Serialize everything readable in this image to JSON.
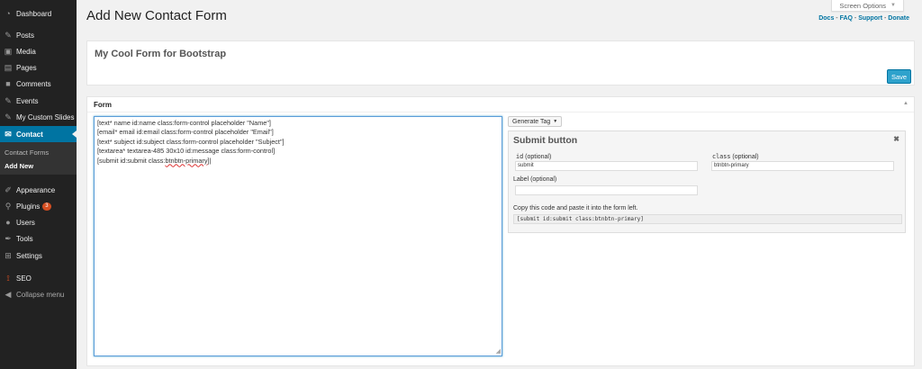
{
  "sidebar": {
    "items": [
      {
        "label": "Dashboard",
        "icon": "dashboard-icon"
      },
      {
        "label": "Posts",
        "icon": "pin-icon"
      },
      {
        "label": "Media",
        "icon": "media-icon"
      },
      {
        "label": "Pages",
        "icon": "pages-icon"
      },
      {
        "label": "Comments",
        "icon": "comment-icon"
      },
      {
        "label": "Events",
        "icon": "pin-icon"
      },
      {
        "label": "My Custom Slides",
        "icon": "pin-icon"
      },
      {
        "label": "Contact",
        "icon": "mail-icon"
      },
      {
        "label": "Appearance",
        "icon": "paintbrush-icon"
      },
      {
        "label": "Plugins",
        "icon": "plugin-icon",
        "badge": "3"
      },
      {
        "label": "Users",
        "icon": "users-icon"
      },
      {
        "label": "Tools",
        "icon": "wrench-icon"
      },
      {
        "label": "Settings",
        "icon": "settings-icon"
      },
      {
        "label": "SEO",
        "icon": "seo-icon"
      },
      {
        "label": "Collapse menu",
        "icon": "collapse-icon"
      }
    ],
    "submenu": [
      "Contact Forms",
      "Add New"
    ]
  },
  "header": {
    "title": "Add New Contact Form",
    "screen_options": "Screen Options",
    "links": {
      "docs": "Docs",
      "faq": "FAQ",
      "support": "Support",
      "donate": "Donate",
      "sep": " - "
    }
  },
  "title_box": {
    "form_title": "My Cool Form for Bootstrap",
    "save_label": "Save"
  },
  "form_panel": {
    "header": "Form",
    "code_lines": [
      "[text* name id:name class:form-control placeholder \"Name\"]",
      "[email* email id:email class:form-control placeholder \"Email\"]",
      "[text* subject id:subject class:form-control placeholder \"Subject\"]",
      "[textarea* textarea-485 30x10 id:message class:form-control]"
    ],
    "last_line_prefix": "[submit id:submit class:",
    "last_line_misspelled": "btnbtn-primary",
    "last_line_suffix": "]",
    "generate_tag": "Generate Tag",
    "tag_pane": {
      "title": "Submit button",
      "id_label": "id",
      "id_optional": "(optional)",
      "id_value": "submit",
      "class_label": "class",
      "class_optional": "(optional)",
      "class_value": "btnbtn-primary",
      "label_label": "Label (optional)",
      "label_value": "",
      "copy_note": "Copy this code and paste it into the form left.",
      "code_output": "[submit id:submit class:btnbtn-primary]"
    }
  },
  "colors": {
    "sidebar_bg": "#222222",
    "active_bg": "#0074a2",
    "link": "#0074a2",
    "save_button": "#2ea2cc",
    "badge": "#d54e21"
  }
}
